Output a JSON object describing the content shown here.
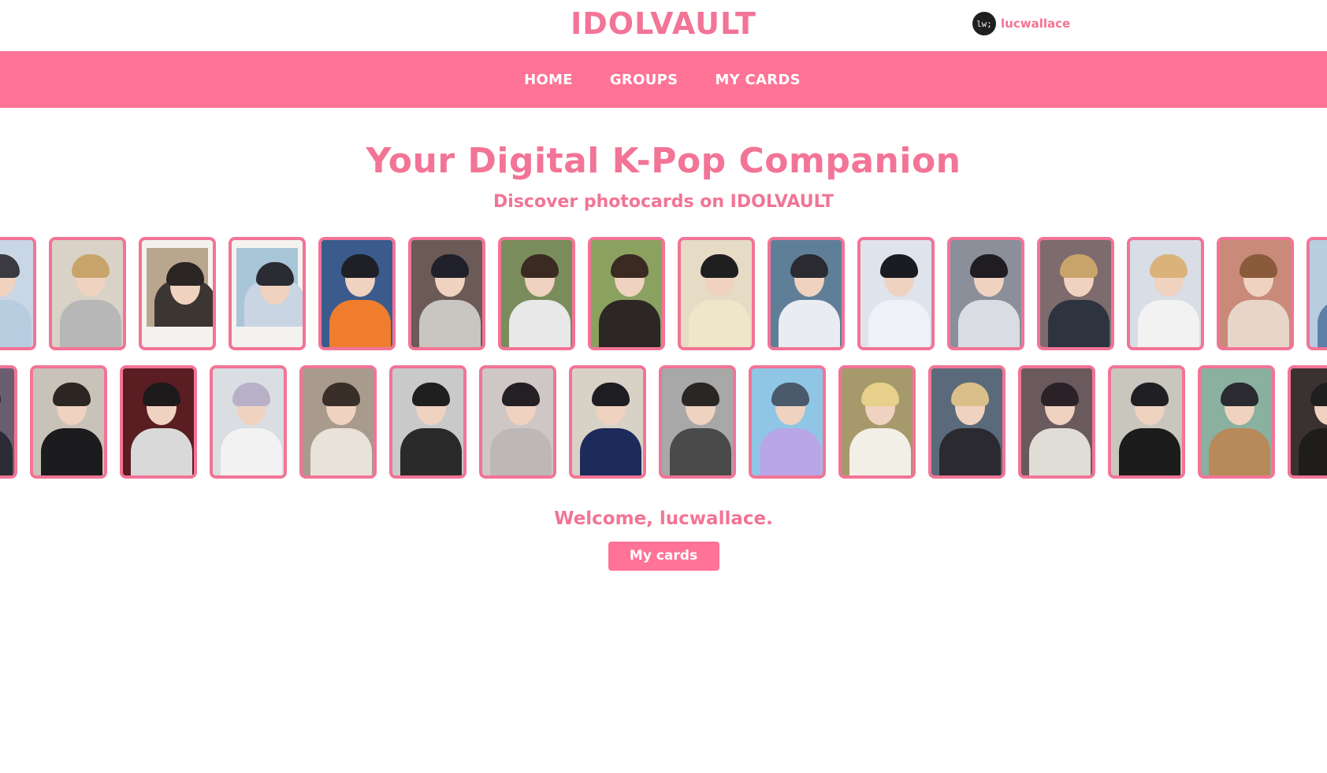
{
  "header": {
    "brand": "IDOLVAULT",
    "user": {
      "avatar_text": "lw;",
      "username": "lucwallace"
    }
  },
  "nav": {
    "items": [
      {
        "label": "HOME"
      },
      {
        "label": "GROUPS"
      },
      {
        "label": "MY CARDS"
      }
    ]
  },
  "hero": {
    "title": "Your Digital K-Pop Companion",
    "subtitle": "Discover photocards on IDOLVAULT"
  },
  "colors": {
    "accent": "#f27496",
    "nav_bg": "#ff7396",
    "button_bg": "#ff7396",
    "text_on_accent": "#ffffff"
  },
  "carousel": {
    "row1": [
      {
        "bg": "#c9d6e6",
        "hair": "#3a3a40",
        "outfit": "#b8cde0",
        "style": "photo"
      },
      {
        "bg": "#d9d2c6",
        "hair": "#c9a46a",
        "outfit": "#b7b7b7",
        "style": "photo"
      },
      {
        "bg": "#b9a68e",
        "hair": "#2a2522",
        "outfit": "#3b3631",
        "style": "polaroid"
      },
      {
        "bg": "#a9c6d8",
        "hair": "#2b2b33",
        "outfit": "#c9d5e2",
        "style": "polaroid"
      },
      {
        "bg": "#3a5b8c",
        "hair": "#1f1f26",
        "outfit": "#f07d2d",
        "style": "photo"
      },
      {
        "bg": "#6b5a55",
        "hair": "#20202a",
        "outfit": "#c9c5c0",
        "style": "photo"
      },
      {
        "bg": "#7a8c5c",
        "hair": "#3a2a22",
        "outfit": "#e8e8e8",
        "style": "photo"
      },
      {
        "bg": "#8aa160",
        "hair": "#3a2a22",
        "outfit": "#2c2624",
        "style": "photo"
      },
      {
        "bg": "#e6dcc6",
        "hair": "#1f1f1f",
        "outfit": "#efe6c9",
        "style": "photo"
      },
      {
        "bg": "#5f7f99",
        "hair": "#2a2a30",
        "outfit": "#e9edf2",
        "style": "photo"
      },
      {
        "bg": "#dfe4ec",
        "hair": "#1b1b22",
        "outfit": "#eef1f7",
        "style": "photo"
      },
      {
        "bg": "#8a8f9a",
        "hair": "#1f1d22",
        "outfit": "#d9dde3",
        "style": "photo"
      },
      {
        "bg": "#7d6b6e",
        "hair": "#c9a46a",
        "outfit": "#2d3440",
        "style": "photo"
      },
      {
        "bg": "#d9dde6",
        "hair": "#d9b37a",
        "outfit": "#f2f2f2",
        "style": "photo"
      },
      {
        "bg": "#c98a7a",
        "hair": "#8a5a3a",
        "outfit": "#e7d6c8",
        "style": "photo"
      },
      {
        "bg": "#b8cde0",
        "hair": "#2a2a30",
        "outfit": "#5d7fa8",
        "style": "photo"
      }
    ],
    "row2": [
      {
        "bg": "#6a5d6e",
        "hair": "#1f1f26",
        "outfit": "#2c2c36",
        "style": "photo"
      },
      {
        "bg": "#c9c2b8",
        "hair": "#2b2622",
        "outfit": "#1c1c1f",
        "style": "photo"
      },
      {
        "bg": "#5a1d22",
        "hair": "#1d1a1c",
        "outfit": "#d9d9d9",
        "style": "photo"
      },
      {
        "bg": "#dadde2",
        "hair": "#b8b0c6",
        "outfit": "#f2f2f2",
        "style": "photo"
      },
      {
        "bg": "#a89a8c",
        "hair": "#3a2f28",
        "outfit": "#e8e2da",
        "style": "photo"
      },
      {
        "bg": "#c9c9c9",
        "hair": "#1f1f1f",
        "outfit": "#2a2a2a",
        "style": "photo"
      },
      {
        "bg": "#cfc6c6",
        "hair": "#241f22",
        "outfit": "#bdb7b7",
        "style": "photo"
      },
      {
        "bg": "#d8d2c6",
        "hair": "#1e1d22",
        "outfit": "#1c2b5a",
        "style": "photo"
      },
      {
        "bg": "#a8a8a8",
        "hair": "#2a2624",
        "outfit": "#4a4a4a",
        "style": "photo"
      },
      {
        "bg": "#8fc6e6",
        "hair": "#4a5a6a",
        "outfit": "#b8a6e6",
        "style": "photo"
      },
      {
        "bg": "#a69a6c",
        "hair": "#e6d08a",
        "outfit": "#f2efe6",
        "style": "photo"
      },
      {
        "bg": "#5a6a7a",
        "hair": "#d9c08a",
        "outfit": "#2a2a30",
        "style": "photo"
      },
      {
        "bg": "#6a5a5e",
        "hair": "#2a2226",
        "outfit": "#e0dcd6",
        "style": "photo"
      },
      {
        "bg": "#c9c6be",
        "hair": "#1f1f24",
        "outfit": "#1c1c1c",
        "style": "photo"
      },
      {
        "bg": "#8ab0a0",
        "hair": "#2a2a30",
        "outfit": "#b88a5a",
        "style": "photo"
      },
      {
        "bg": "#3a3230",
        "hair": "#1f1f1f",
        "outfit": "#1f1c1c",
        "style": "photo"
      }
    ]
  },
  "welcome": {
    "text": "Welcome, lucwallace.",
    "button_label": "My cards"
  }
}
